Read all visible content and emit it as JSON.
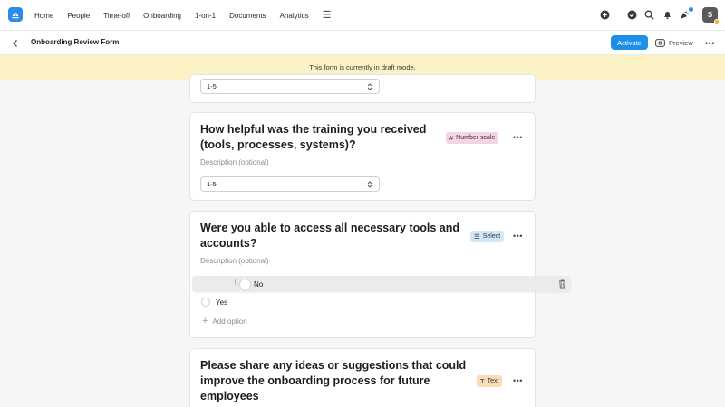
{
  "nav": {
    "links": [
      "Home",
      "People",
      "Time-off",
      "Onboarding",
      "1-on-1",
      "Documents",
      "Analytics"
    ],
    "avatar_initial": "S",
    "icons": [
      "plus-circle-icon",
      "check-circle-icon",
      "search-icon",
      "bell-icon",
      "celebration-icon",
      "hamburger-menu-icon"
    ]
  },
  "header": {
    "title": "Onboarding Review Form",
    "activate_label": "Activate",
    "preview_label": "Preview"
  },
  "banner": {
    "text": "This form is currently in draft mode."
  },
  "questions": [
    {
      "select_value": "1-5"
    },
    {
      "title_line1": "How helpful was the training you received",
      "title_line2": "(tools, processes, systems)?",
      "description_placeholder": "Description (optional)",
      "tag": "Number scale",
      "select_value": "1-5"
    },
    {
      "title_line1": "Were you able to access all necessary tools and",
      "title_line2": "accounts?",
      "description_placeholder": "Description (optional)",
      "tag": "Select",
      "options": [
        "No",
        "Yes"
      ],
      "add_option_label": "Add option"
    },
    {
      "title_line1": "Please share any ideas or suggestions that could",
      "title_line2": "improve the onboarding process for future",
      "title_line3": "employees",
      "tag": "Text"
    }
  ],
  "colors": {
    "accent": "#1e8fe6",
    "banner": "#faf1c4",
    "tag_number_scale": "#f7d3e6",
    "tag_select": "#cfe9f7",
    "tag_text": "#fbdcb8"
  }
}
